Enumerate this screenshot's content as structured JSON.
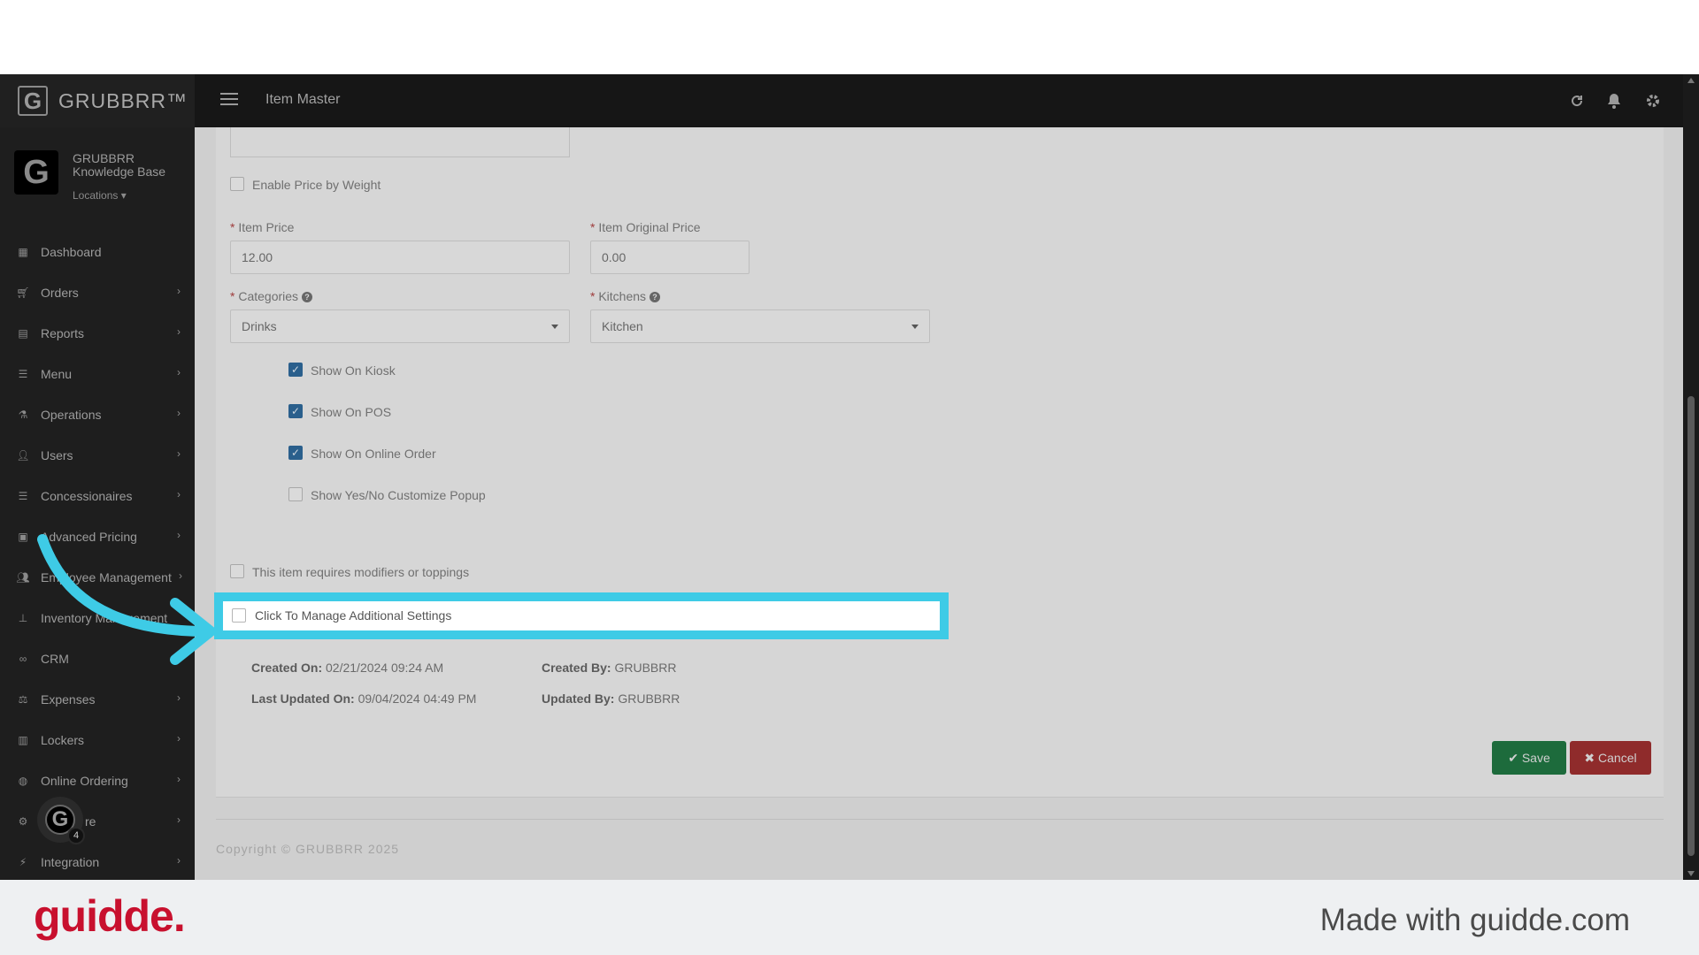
{
  "app": {
    "brand_name": "GRUBBRR™",
    "brand_logo_letter": "G",
    "page_title": "Item Master"
  },
  "sidebar": {
    "profile_letter": "G",
    "org_name": "GRUBBRR Knowledge Base",
    "locations_label": "Locations",
    "items": [
      {
        "label": "Dashboard",
        "icon": "dashboard-icon",
        "chevron": false
      },
      {
        "label": "Orders",
        "icon": "cart-icon",
        "chevron": true
      },
      {
        "label": "Reports",
        "icon": "report-icon",
        "chevron": true
      },
      {
        "label": "Menu",
        "icon": "list-icon",
        "chevron": true
      },
      {
        "label": "Operations",
        "icon": "flask-icon",
        "chevron": true
      },
      {
        "label": "Users",
        "icon": "user-add-icon",
        "chevron": true
      },
      {
        "label": "Concessionaires",
        "icon": "list-icon",
        "chevron": true
      },
      {
        "label": "Advanced Pricing",
        "icon": "money-icon",
        "chevron": true
      },
      {
        "label": "Employee Management",
        "icon": "users-icon",
        "chevron": true
      },
      {
        "label": "Inventory Management",
        "icon": "sitemap-icon",
        "chevron": false
      },
      {
        "label": "CRM",
        "icon": "link-icon",
        "chevron": false
      },
      {
        "label": "Expenses",
        "icon": "scale-icon",
        "chevron": true
      },
      {
        "label": "Lockers",
        "icon": "locker-icon",
        "chevron": true
      },
      {
        "label": "Online Ordering",
        "icon": "globe-icon",
        "chevron": true
      },
      {
        "label": "re",
        "icon": "gear-icon",
        "chevron": true
      },
      {
        "label": "Integration",
        "icon": "plug-icon",
        "chevron": true
      }
    ],
    "float_badge_letter": "G",
    "float_badge_count": "4"
  },
  "form": {
    "enable_price_by_weight": "Enable Price by Weight",
    "item_price_label": "Item Price",
    "item_price_value": "12.00",
    "item_original_price_label": "Item Original Price",
    "item_original_price_value": "0.00",
    "categories_label": "Categories",
    "categories_value": "Drinks",
    "kitchens_label": "Kitchens",
    "kitchens_value": "Kitchen",
    "required_mark": "*",
    "help_mark": "?",
    "show_on_kiosk": "Show On Kiosk",
    "show_on_pos": "Show On POS",
    "show_on_online_order": "Show On Online Order",
    "show_yes_no_popup": "Show Yes/No Customize Popup",
    "requires_modifiers": "This item requires modifiers or toppings",
    "manage_additional_settings": "Click To Manage Additional Settings",
    "show_on_kiosk_checked": true,
    "show_on_pos_checked": true,
    "show_on_online_order_checked": true
  },
  "meta": {
    "created_on_label": "Created On:",
    "created_on_value": "02/21/2024 09:24 AM",
    "created_by_label": "Created By:",
    "created_by_value": "GRUBBRR",
    "last_updated_on_label": "Last Updated On:",
    "last_updated_on_value": "09/04/2024 04:49 PM",
    "updated_by_label": "Updated By:",
    "updated_by_value": "GRUBBRR"
  },
  "actions": {
    "save_label": "Save",
    "cancel_label": "Cancel"
  },
  "footer": {
    "copyright": "Copyright © GRUBBRR 2025"
  },
  "banner": {
    "logo_text": "guidde.",
    "made_with": "Made with guidde.com"
  },
  "colors": {
    "highlight": "#3ecbe6",
    "save": "#1d6b3c",
    "cancel": "#8f2b2b",
    "brand_red": "#c8102e"
  }
}
